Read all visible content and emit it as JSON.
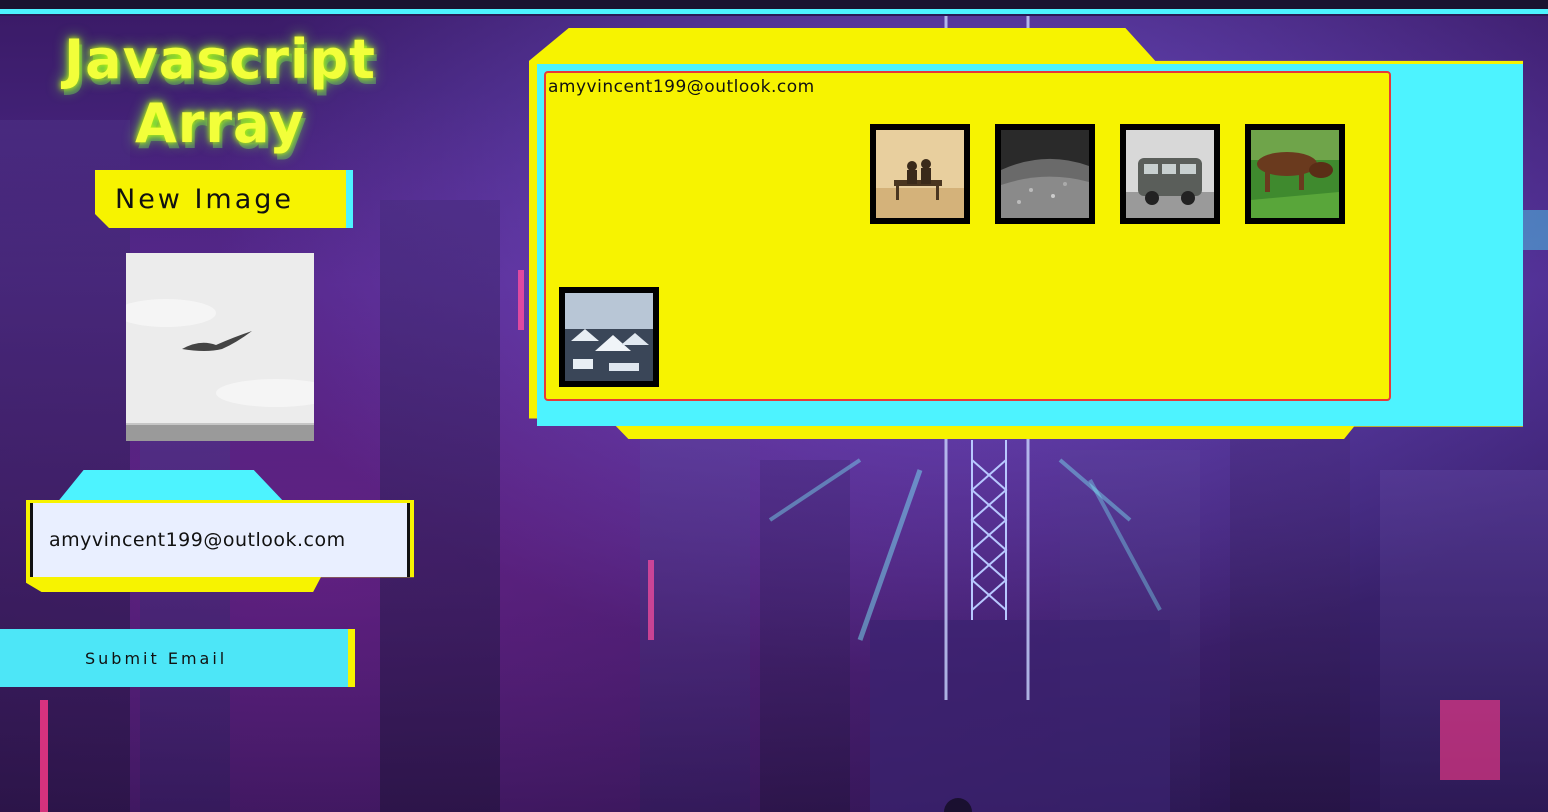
{
  "page": {
    "title": "Javascript Array",
    "new_image_label": "New Image",
    "submit_label": "Submit Email",
    "email_value": "amyvincent199@outlook.com"
  },
  "collection": {
    "email": "amyvincent199@outlook.com",
    "thumbnails": [
      {
        "name": "bench-couple-thumbnail"
      },
      {
        "name": "gravel-thumbnail"
      },
      {
        "name": "vw-bus-thumbnail"
      },
      {
        "name": "dogs-in-grass-thumbnail"
      },
      {
        "name": "snowy-rooftops-thumbnail"
      }
    ]
  },
  "preview": {
    "name": "bird-in-sky-preview"
  },
  "colors": {
    "yellow": "#f7f300",
    "cyan": "#4df3ff",
    "neon_green": "#f2ff3a",
    "card_border": "#e53a3a",
    "input_bg": "#e9efff"
  }
}
